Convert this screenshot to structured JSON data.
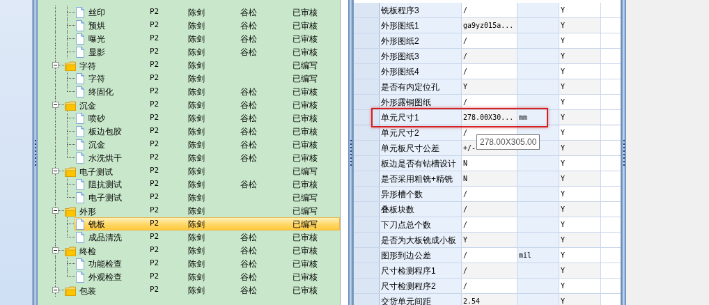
{
  "tree": [
    {
      "name": "丝印",
      "level": "P2",
      "author": "陈剑",
      "reviewer": "谷松",
      "status": "已审核",
      "kind": "leaf",
      "selected": false
    },
    {
      "name": "预烘",
      "level": "P2",
      "author": "陈剑",
      "reviewer": "谷松",
      "status": "已审核",
      "kind": "leaf",
      "selected": false
    },
    {
      "name": "曝光",
      "level": "P2",
      "author": "陈剑",
      "reviewer": "谷松",
      "status": "已审核",
      "kind": "leaf",
      "selected": false
    },
    {
      "name": "显影",
      "level": "P2",
      "author": "陈剑",
      "reviewer": "谷松",
      "status": "已审核",
      "kind": "leaf",
      "selected": false
    },
    {
      "name": "字符",
      "level": "P2",
      "author": "陈剑",
      "status": "已编写",
      "kind": "group",
      "selected": false,
      "expanded": true,
      "children": [
        {
          "name": "字符",
          "level": "P2",
          "author": "陈剑",
          "status": "已编写",
          "kind": "leaf",
          "selected": false
        },
        {
          "name": "终固化",
          "level": "P2",
          "author": "陈剑",
          "reviewer": "谷松",
          "status": "已审核",
          "kind": "leaf",
          "selected": false
        }
      ]
    },
    {
      "name": "沉金",
      "level": "P2",
      "author": "陈剑",
      "reviewer": "谷松",
      "status": "已审核",
      "kind": "group",
      "selected": false,
      "expanded": true,
      "children": [
        {
          "name": "喷砂",
          "level": "P2",
          "author": "陈剑",
          "reviewer": "谷松",
          "status": "已审核",
          "kind": "leaf",
          "selected": false
        },
        {
          "name": "板边包胶",
          "level": "P2",
          "author": "陈剑",
          "reviewer": "谷松",
          "status": "已审核",
          "kind": "leaf",
          "selected": false
        },
        {
          "name": "沉金",
          "level": "P2",
          "author": "陈剑",
          "reviewer": "谷松",
          "status": "已审核",
          "kind": "leaf",
          "selected": false
        },
        {
          "name": "水洗烘干",
          "level": "P2",
          "author": "陈剑",
          "reviewer": "谷松",
          "status": "已审核",
          "kind": "leaf",
          "selected": false
        }
      ]
    },
    {
      "name": "电子测试",
      "level": "P2",
      "author": "陈剑",
      "status": "已编写",
      "kind": "group",
      "selected": false,
      "expanded": true,
      "children": [
        {
          "name": "阻抗测试",
          "level": "P2",
          "author": "陈剑",
          "reviewer": "谷松",
          "status": "已审核",
          "kind": "leaf",
          "selected": false
        },
        {
          "name": "电子测试",
          "level": "P2",
          "author": "陈剑",
          "status": "已编写",
          "kind": "leaf",
          "selected": false
        }
      ]
    },
    {
      "name": "外形",
      "level": "P2",
      "author": "陈剑",
      "status": "已编写",
      "kind": "group",
      "selected": false,
      "expanded": true,
      "children": [
        {
          "name": "铣板",
          "level": "P2",
          "author": "陈剑",
          "status": "已编写",
          "kind": "leaf",
          "selected": true
        },
        {
          "name": "成品清洗",
          "level": "P2",
          "author": "陈剑",
          "reviewer": "谷松",
          "status": "已审核",
          "kind": "leaf",
          "selected": false
        }
      ]
    },
    {
      "name": "终检",
      "level": "P2",
      "author": "陈剑",
      "reviewer": "谷松",
      "status": "已审核",
      "kind": "group",
      "selected": false,
      "expanded": true,
      "children": [
        {
          "name": "功能检查",
          "level": "P2",
          "author": "陈剑",
          "reviewer": "谷松",
          "status": "已审核",
          "kind": "leaf",
          "selected": false
        },
        {
          "name": "外观检查",
          "level": "P2",
          "author": "陈剑",
          "reviewer": "谷松",
          "status": "已审核",
          "kind": "leaf",
          "selected": false
        }
      ]
    },
    {
      "name": "包装",
      "level": "P2",
      "author": "陈剑",
      "reviewer": "谷松",
      "status": "已审核",
      "kind": "group",
      "selected": false,
      "expanded": true
    }
  ],
  "grid": [
    {
      "name": "铣板程序3",
      "value": "/",
      "check": "Y",
      "highlighted": false
    },
    {
      "name": "外形图纸1",
      "value": "ga9yz015a...",
      "check": "Y",
      "highlighted": false
    },
    {
      "name": "外形图纸2",
      "value": "/",
      "check": "Y",
      "highlighted": false
    },
    {
      "name": "外形图纸3",
      "value": "/",
      "check": "Y",
      "highlighted": false
    },
    {
      "name": "外形图纸4",
      "value": "/",
      "check": "Y",
      "highlighted": false
    },
    {
      "name": "是否有内定位孔",
      "value": "Y",
      "check": "Y",
      "highlighted": false
    },
    {
      "name": "外形露铜图纸",
      "value": "/",
      "check": "Y",
      "highlighted": false
    },
    {
      "name": "单元尺寸1",
      "value": "278.00X30...",
      "unit": "mm",
      "check": "Y",
      "highlighted": true
    },
    {
      "name": "单元尺寸2",
      "value": "/",
      "check": "Y",
      "highlighted": false
    },
    {
      "name": "单元板尺寸公差",
      "value": "+/-",
      "check": "Y",
      "highlighted": false
    },
    {
      "name": "板边是否有钻槽设计",
      "value": "N",
      "check": "Y",
      "highlighted": false
    },
    {
      "name": "是否采用粗铣+精铣",
      "value": "N",
      "check": "Y",
      "highlighted": false
    },
    {
      "name": "异形槽个数",
      "value": "/",
      "check": "Y",
      "highlighted": false
    },
    {
      "name": "叠板块数",
      "value": "/",
      "check": "Y",
      "highlighted": false
    },
    {
      "name": "下刀点总个数",
      "value": "/",
      "check": "Y",
      "highlighted": false
    },
    {
      "name": "是否为大板铣成小板",
      "value": "Y",
      "check": "Y",
      "highlighted": false
    },
    {
      "name": "图形到边公差",
      "value": "/",
      "unit": "mil",
      "check": "Y",
      "highlighted": false
    },
    {
      "name": "尺寸检测程序1",
      "value": "/",
      "check": "Y",
      "highlighted": false
    },
    {
      "name": "尺寸检测程序2",
      "value": "/",
      "check": "Y",
      "highlighted": false
    },
    {
      "name": "交货单元间距",
      "value": "2.54",
      "check": "Y",
      "highlighted": false
    }
  ],
  "tooltip": {
    "text": "278.00X305.00"
  }
}
